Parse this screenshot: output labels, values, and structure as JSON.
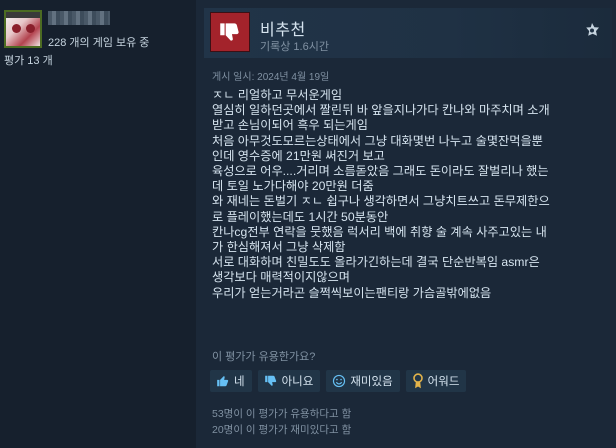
{
  "user": {
    "games_owned": "228 개의 게임 보유 중",
    "review_count": "평가 13 개"
  },
  "review": {
    "verdict": "비추천",
    "hours": "기록상 1.6시간",
    "posted": "게시 일시: 2024년 4월 19일",
    "lines": [
      "ㅈㄴ 리얼하고 무서운게임",
      "열심히 일하던곳에서 짤린뒤 바 앞을지나가다 칸나와 마주치며 소개",
      "받고 손님이되어 흑우 되는게임",
      "처음 아무것도모르는상태에서 그냥 대화몇번 나누고 술몇잔먹을뿐",
      "인데 영수증에 21만원 써진거 보고",
      "육성으로 어우....거리며 소름돋았음 그래도 돈이라도 잘벌리나 했는",
      "데 토일 노가다해야 20만원 더줌",
      "와 재네는 돈벌기 ㅈㄴ 쉽구나 생각하면서 그냥치트쓰고 돈무제한으",
      "로 플레이했는데도 1시간 50분동안",
      "칸나cg전부 연락을 뭇했음 럭서리 백에 취향 술 계속 사주고있는 내",
      "가 한심해져서 그냥 삭제함",
      "서로 대화하며 친밀도도 올라가긴하는데 결국 단순반복임 asmr은",
      "생각보다 매력적이지않으며",
      "우리가 얻는거라곤 슬쩍씩보이는팬티랑 가슴골밖에없음"
    ]
  },
  "helpful": {
    "question": "이 평가가 유용한가요?",
    "buttons": {
      "yes": "네",
      "no": "아니요",
      "funny": "재미있음",
      "award": "어워드"
    },
    "stats": {
      "helpful": "53명이 이 평가가 유용하다고 함",
      "funny": "20명이 이 평가가 재미있다고 함"
    }
  },
  "colors": {
    "thumb_down_bg": "#a3232b",
    "background": "#1b2838",
    "sidebar": "#16202d"
  },
  "icons": {
    "verdict": "thumbs-down-icon",
    "platform": "steam-icon",
    "yes": "thumbs-up-icon",
    "no": "thumbs-down-icon",
    "funny": "smile-icon",
    "award": "award-icon"
  }
}
